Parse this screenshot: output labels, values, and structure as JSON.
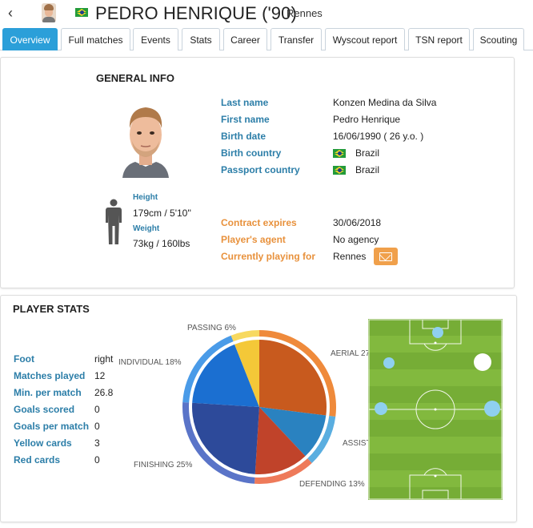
{
  "header": {
    "player_name": "PEDRO HENRIQUE ('90)",
    "club": "Rennes",
    "back_icon": "chevron-left-icon",
    "nationality_flag": "brazil-flag"
  },
  "tabs": [
    {
      "label": "Overview",
      "active": true
    },
    {
      "label": "Full matches",
      "active": false
    },
    {
      "label": "Events",
      "active": false
    },
    {
      "label": "Stats",
      "active": false
    },
    {
      "label": "Career",
      "active": false
    },
    {
      "label": "Transfer",
      "active": false
    },
    {
      "label": "Wyscout report",
      "active": false
    },
    {
      "label": "TSN report",
      "active": false
    },
    {
      "label": "Scouting",
      "active": false
    }
  ],
  "general_info": {
    "title": "GENERAL INFO",
    "fields": [
      {
        "label": "Last name",
        "value": "Konzen Medina da Silva"
      },
      {
        "label": "First name",
        "value": "Pedro Henrique"
      },
      {
        "label": "Birth date",
        "value": "16/06/1990 ( 26 y.o. )"
      },
      {
        "label": "Birth country",
        "value": "Brazil"
      },
      {
        "label": "Passport country",
        "value": "Brazil"
      }
    ],
    "contract_fields": [
      {
        "label": "Contract expires",
        "value": "30/06/2018"
      },
      {
        "label": "Player's agent",
        "value": "No agency"
      },
      {
        "label": "Currently playing for",
        "value": "Rennes"
      }
    ],
    "height_label": "Height",
    "height_value": "179cm / 5'10''",
    "weight_label": "Weight",
    "weight_value": "73kg / 160lbs"
  },
  "player_stats": {
    "title": "PLAYER STATS",
    "stats": [
      {
        "label": "Foot",
        "value": "right"
      },
      {
        "label": "Matches played",
        "value": "12"
      },
      {
        "label": "Min. per match",
        "value": "26.8"
      },
      {
        "label": "Goals scored",
        "value": "0"
      },
      {
        "label": "Goals per match",
        "value": "0"
      },
      {
        "label": "Yellow cards",
        "value": "3"
      },
      {
        "label": "Red cards",
        "value": "0"
      }
    ]
  },
  "chart_data": {
    "type": "pie",
    "labels": {
      "passing": "PASSING 6%",
      "aerial": "AERIAL 27",
      "individual": "INDIVIDUAL 18%",
      "assist": "ASSIST",
      "finishing": "FINISHING 25%",
      "defending": "DEFENDING 13%"
    },
    "slices": [
      {
        "name": "AERIAL",
        "value": 27,
        "color": "#c85a1e",
        "ring_color": "#ef8a3b"
      },
      {
        "name": "ASSIST",
        "value": 11,
        "color": "#2a82c0",
        "ring_color": "#5aaee0"
      },
      {
        "name": "DEFENDING",
        "value": 13,
        "color": "#c0432a",
        "ring_color": "#ee7a5a"
      },
      {
        "name": "FINISHING",
        "value": 25,
        "color": "#2d4a9a",
        "ring_color": "#5a74c8"
      },
      {
        "name": "INDIVIDUAL",
        "value": 18,
        "color": "#1b6fd1",
        "ring_color": "#4a9be8"
      },
      {
        "name": "PASSING",
        "value": 6,
        "color": "#f4c838",
        "ring_color": "#f7d960"
      }
    ]
  },
  "colors": {
    "accent": "#2b9fd9",
    "label_blue": "#2c7ea8",
    "label_orange": "#e8913c",
    "pitch_green": "#7fb53a"
  }
}
